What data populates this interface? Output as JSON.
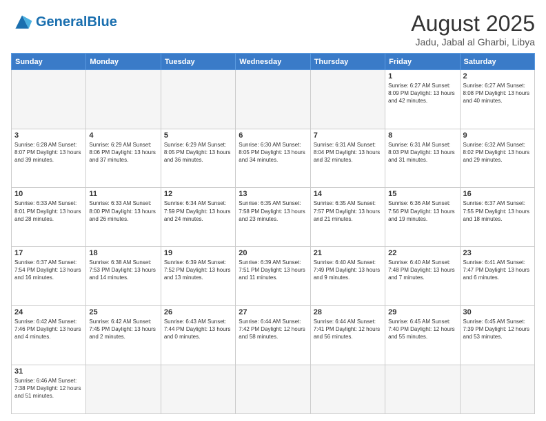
{
  "header": {
    "logo_general": "General",
    "logo_blue": "Blue",
    "month_year": "August 2025",
    "location": "Jadu, Jabal al Gharbi, Libya"
  },
  "weekdays": [
    "Sunday",
    "Monday",
    "Tuesday",
    "Wednesday",
    "Thursday",
    "Friday",
    "Saturday"
  ],
  "weeks": [
    [
      {
        "day": "",
        "info": "",
        "empty": true
      },
      {
        "day": "",
        "info": "",
        "empty": true
      },
      {
        "day": "",
        "info": "",
        "empty": true
      },
      {
        "day": "",
        "info": "",
        "empty": true
      },
      {
        "day": "",
        "info": "",
        "empty": true
      },
      {
        "day": "1",
        "info": "Sunrise: 6:27 AM\nSunset: 8:09 PM\nDaylight: 13 hours and 42 minutes."
      },
      {
        "day": "2",
        "info": "Sunrise: 6:27 AM\nSunset: 8:08 PM\nDaylight: 13 hours and 40 minutes."
      }
    ],
    [
      {
        "day": "3",
        "info": "Sunrise: 6:28 AM\nSunset: 8:07 PM\nDaylight: 13 hours and 39 minutes."
      },
      {
        "day": "4",
        "info": "Sunrise: 6:29 AM\nSunset: 8:06 PM\nDaylight: 13 hours and 37 minutes."
      },
      {
        "day": "5",
        "info": "Sunrise: 6:29 AM\nSunset: 8:05 PM\nDaylight: 13 hours and 36 minutes."
      },
      {
        "day": "6",
        "info": "Sunrise: 6:30 AM\nSunset: 8:05 PM\nDaylight: 13 hours and 34 minutes."
      },
      {
        "day": "7",
        "info": "Sunrise: 6:31 AM\nSunset: 8:04 PM\nDaylight: 13 hours and 32 minutes."
      },
      {
        "day": "8",
        "info": "Sunrise: 6:31 AM\nSunset: 8:03 PM\nDaylight: 13 hours and 31 minutes."
      },
      {
        "day": "9",
        "info": "Sunrise: 6:32 AM\nSunset: 8:02 PM\nDaylight: 13 hours and 29 minutes."
      }
    ],
    [
      {
        "day": "10",
        "info": "Sunrise: 6:33 AM\nSunset: 8:01 PM\nDaylight: 13 hours and 28 minutes."
      },
      {
        "day": "11",
        "info": "Sunrise: 6:33 AM\nSunset: 8:00 PM\nDaylight: 13 hours and 26 minutes."
      },
      {
        "day": "12",
        "info": "Sunrise: 6:34 AM\nSunset: 7:59 PM\nDaylight: 13 hours and 24 minutes."
      },
      {
        "day": "13",
        "info": "Sunrise: 6:35 AM\nSunset: 7:58 PM\nDaylight: 13 hours and 23 minutes."
      },
      {
        "day": "14",
        "info": "Sunrise: 6:35 AM\nSunset: 7:57 PM\nDaylight: 13 hours and 21 minutes."
      },
      {
        "day": "15",
        "info": "Sunrise: 6:36 AM\nSunset: 7:56 PM\nDaylight: 13 hours and 19 minutes."
      },
      {
        "day": "16",
        "info": "Sunrise: 6:37 AM\nSunset: 7:55 PM\nDaylight: 13 hours and 18 minutes."
      }
    ],
    [
      {
        "day": "17",
        "info": "Sunrise: 6:37 AM\nSunset: 7:54 PM\nDaylight: 13 hours and 16 minutes."
      },
      {
        "day": "18",
        "info": "Sunrise: 6:38 AM\nSunset: 7:53 PM\nDaylight: 13 hours and 14 minutes."
      },
      {
        "day": "19",
        "info": "Sunrise: 6:39 AM\nSunset: 7:52 PM\nDaylight: 13 hours and 13 minutes."
      },
      {
        "day": "20",
        "info": "Sunrise: 6:39 AM\nSunset: 7:51 PM\nDaylight: 13 hours and 11 minutes."
      },
      {
        "day": "21",
        "info": "Sunrise: 6:40 AM\nSunset: 7:49 PM\nDaylight: 13 hours and 9 minutes."
      },
      {
        "day": "22",
        "info": "Sunrise: 6:40 AM\nSunset: 7:48 PM\nDaylight: 13 hours and 7 minutes."
      },
      {
        "day": "23",
        "info": "Sunrise: 6:41 AM\nSunset: 7:47 PM\nDaylight: 13 hours and 6 minutes."
      }
    ],
    [
      {
        "day": "24",
        "info": "Sunrise: 6:42 AM\nSunset: 7:46 PM\nDaylight: 13 hours and 4 minutes."
      },
      {
        "day": "25",
        "info": "Sunrise: 6:42 AM\nSunset: 7:45 PM\nDaylight: 13 hours and 2 minutes."
      },
      {
        "day": "26",
        "info": "Sunrise: 6:43 AM\nSunset: 7:44 PM\nDaylight: 13 hours and 0 minutes."
      },
      {
        "day": "27",
        "info": "Sunrise: 6:44 AM\nSunset: 7:42 PM\nDaylight: 12 hours and 58 minutes."
      },
      {
        "day": "28",
        "info": "Sunrise: 6:44 AM\nSunset: 7:41 PM\nDaylight: 12 hours and 56 minutes."
      },
      {
        "day": "29",
        "info": "Sunrise: 6:45 AM\nSunset: 7:40 PM\nDaylight: 12 hours and 55 minutes."
      },
      {
        "day": "30",
        "info": "Sunrise: 6:45 AM\nSunset: 7:39 PM\nDaylight: 12 hours and 53 minutes."
      }
    ],
    [
      {
        "day": "31",
        "info": "Sunrise: 6:46 AM\nSunset: 7:38 PM\nDaylight: 12 hours and 51 minutes."
      },
      {
        "day": "",
        "info": "",
        "empty": true
      },
      {
        "day": "",
        "info": "",
        "empty": true
      },
      {
        "day": "",
        "info": "",
        "empty": true
      },
      {
        "day": "",
        "info": "",
        "empty": true
      },
      {
        "day": "",
        "info": "",
        "empty": true
      },
      {
        "day": "",
        "info": "",
        "empty": true
      }
    ]
  ]
}
